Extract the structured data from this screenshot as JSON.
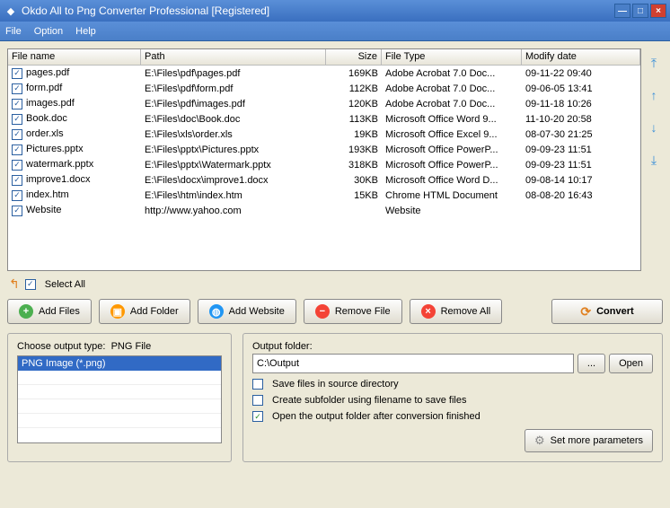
{
  "window": {
    "title": "Okdo All to Png Converter Professional [Registered]"
  },
  "menu": {
    "file": "File",
    "option": "Option",
    "help": "Help"
  },
  "columns": {
    "name": "File name",
    "path": "Path",
    "size": "Size",
    "type": "File Type",
    "date": "Modify date"
  },
  "files": [
    {
      "name": "pages.pdf",
      "path": "E:\\Files\\pdf\\pages.pdf",
      "size": "169KB",
      "type": "Adobe Acrobat 7.0 Doc...",
      "date": "09-11-22 09:40"
    },
    {
      "name": "form.pdf",
      "path": "E:\\Files\\pdf\\form.pdf",
      "size": "112KB",
      "type": "Adobe Acrobat 7.0 Doc...",
      "date": "09-06-05 13:41"
    },
    {
      "name": "images.pdf",
      "path": "E:\\Files\\pdf\\images.pdf",
      "size": "120KB",
      "type": "Adobe Acrobat 7.0 Doc...",
      "date": "09-11-18 10:26"
    },
    {
      "name": "Book.doc",
      "path": "E:\\Files\\doc\\Book.doc",
      "size": "113KB",
      "type": "Microsoft Office Word 9...",
      "date": "11-10-20 20:58"
    },
    {
      "name": "order.xls",
      "path": "E:\\Files\\xls\\order.xls",
      "size": "19KB",
      "type": "Microsoft Office Excel 9...",
      "date": "08-07-30 21:25"
    },
    {
      "name": "Pictures.pptx",
      "path": "E:\\Files\\pptx\\Pictures.pptx",
      "size": "193KB",
      "type": "Microsoft Office PowerP...",
      "date": "09-09-23 11:51"
    },
    {
      "name": "watermark.pptx",
      "path": "E:\\Files\\pptx\\Watermark.pptx",
      "size": "318KB",
      "type": "Microsoft Office PowerP...",
      "date": "09-09-23 11:51"
    },
    {
      "name": "improve1.docx",
      "path": "E:\\Files\\docx\\improve1.docx",
      "size": "30KB",
      "type": "Microsoft Office Word D...",
      "date": "09-08-14 10:17"
    },
    {
      "name": "index.htm",
      "path": "E:\\Files\\htm\\index.htm",
      "size": "15KB",
      "type": "Chrome HTML Document",
      "date": "08-08-20 16:43"
    },
    {
      "name": "Website",
      "path": "http://www.yahoo.com",
      "size": "",
      "type": "Website",
      "date": ""
    }
  ],
  "selectall": "Select All",
  "buttons": {
    "addfiles": "Add Files",
    "addfolder": "Add Folder",
    "addwebsite": "Add Website",
    "removefile": "Remove File",
    "removeall": "Remove All",
    "convert": "Convert"
  },
  "output": {
    "typeLabel": "Choose output type:",
    "typeValue": "PNG File",
    "typeOption": "PNG Image (*.png)",
    "folderLabel": "Output folder:",
    "folderValue": "C:\\Output",
    "browse": "...",
    "open": "Open",
    "opt1": "Save files in source directory",
    "opt2": "Create subfolder using filename to save files",
    "opt3": "Open the output folder after conversion finished",
    "more": "Set more parameters"
  }
}
